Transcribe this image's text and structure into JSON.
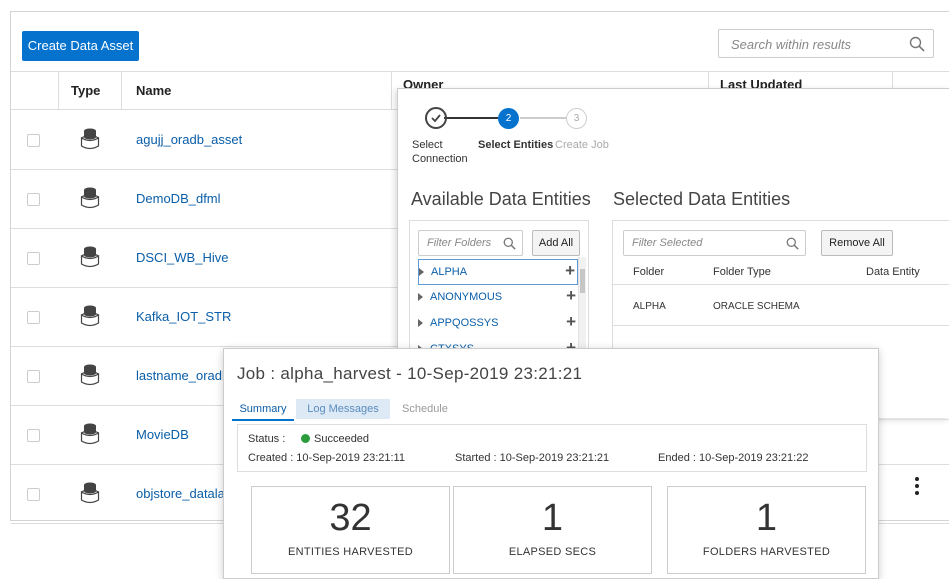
{
  "toolbar": {
    "create_label": "Create Data Asset",
    "search_placeholder": "Search within results"
  },
  "table": {
    "headers": {
      "type": "Type",
      "name": "Name",
      "owner": "Owner",
      "updated": "Last Updated"
    },
    "rows": [
      {
        "name": "agujj_oradb_asset"
      },
      {
        "name": "DemoDB_dfml"
      },
      {
        "name": "DSCI_WB_Hive"
      },
      {
        "name": "Kafka_IOT_STR"
      },
      {
        "name": "lastname_oradb_"
      },
      {
        "name": "MovieDB"
      },
      {
        "name": "objstore_datalak"
      }
    ]
  },
  "wizard": {
    "steps": [
      {
        "label": "Select Connection",
        "num": "",
        "state": "done"
      },
      {
        "label": "Select Entities",
        "num": "2",
        "state": "active"
      },
      {
        "label": "Create Job",
        "num": "3",
        "state": "pending"
      }
    ],
    "available_title": "Available Data Entities",
    "selected_title": "Selected Data Entities",
    "filter_folders_placeholder": "Filter Folders",
    "add_all_label": "Add All",
    "filter_selected_placeholder": "Filter Selected",
    "remove_all_label": "Remove All",
    "folders": [
      "ALPHA",
      "ANONYMOUS",
      "APPQOSSYS",
      "CTXSYS"
    ],
    "selected_headers": {
      "folder": "Folder",
      "folder_type": "Folder Type",
      "entity": "Data Entity"
    },
    "selected_rows": [
      {
        "folder": "ALPHA",
        "folder_type": "ORACLE SCHEMA"
      }
    ]
  },
  "job": {
    "title": "Job : alpha_harvest - 10-Sep-2019 23:21:21",
    "tabs": [
      "Summary",
      "Log Messages",
      "Schedule"
    ],
    "status_prefix": "Status :",
    "status": "Succeeded",
    "status_color": "#2a9d3a",
    "created": "Created : 10-Sep-2019 23:21:11",
    "started": "Started : 10-Sep-2019 23:21:21",
    "ended": "Ended : 10-Sep-2019 23:21:22",
    "stats": [
      {
        "value": "32",
        "label": "ENTITIES HARVESTED"
      },
      {
        "value": "1",
        "label": "ELAPSED SECS"
      },
      {
        "value": "1",
        "label": "FOLDERS HARVESTED"
      }
    ]
  },
  "colors": {
    "accent": "#0572ce",
    "link": "#0a5ea8"
  }
}
